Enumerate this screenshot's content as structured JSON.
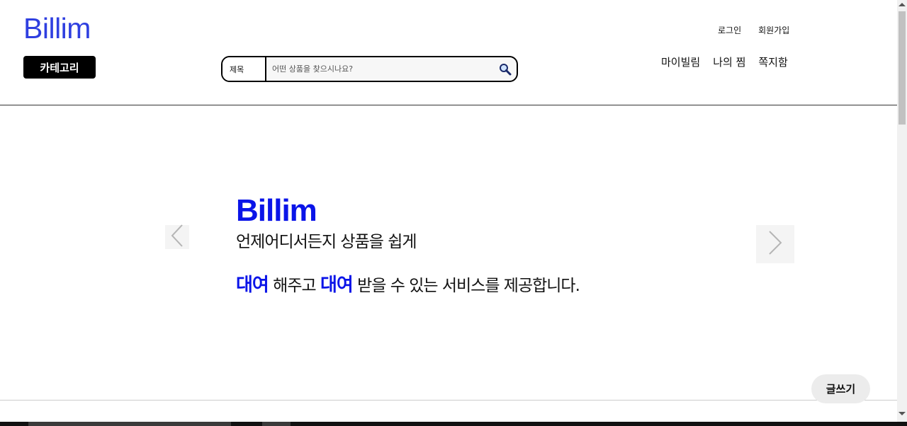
{
  "header": {
    "logo": "Billim",
    "category_label": "카테고리",
    "search": {
      "type_label": "제목",
      "placeholder": "어떤 상품을 찾으시나요?"
    },
    "top_links": [
      "로그인",
      "회원가입"
    ],
    "nav": [
      "마이빌림",
      "나의 찜",
      "쪽지함"
    ]
  },
  "hero": {
    "title": "Billim",
    "subtitle": "언제어디서든지 상품을 쉽게",
    "desc": {
      "accent1": "대여",
      "text1": " 해주고 ",
      "accent2": "대여",
      "text2": " 받을 수 있는 서비스를 제공합니다."
    }
  },
  "write_label": "글쓰기",
  "colors": {
    "brand": "#2f3fe0",
    "accent": "#0a14e8"
  },
  "icons": {
    "search": "search-icon",
    "prev": "chevron-left-icon",
    "next": "chevron-right-icon"
  }
}
